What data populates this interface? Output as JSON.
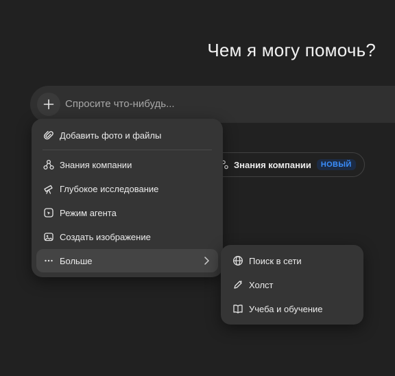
{
  "heading": "Чем я могу помочь?",
  "composer": {
    "placeholder": "Спросите что-нибудь..."
  },
  "chip": {
    "label": "Знания компании",
    "badge": "НОВЫЙ"
  },
  "menu": {
    "items": [
      {
        "label": "Добавить фото и файлы",
        "icon": "paperclip-icon"
      },
      {
        "label": "Знания компании",
        "icon": "connectors-icon"
      },
      {
        "label": "Глубокое исследование",
        "icon": "telescope-icon"
      },
      {
        "label": "Режим агента",
        "icon": "agent-icon"
      },
      {
        "label": "Создать изображение",
        "icon": "image-icon"
      },
      {
        "label": "Больше",
        "icon": "ellipsis-icon"
      }
    ]
  },
  "submenu": {
    "items": [
      {
        "label": "Поиск в сети",
        "icon": "globe-icon"
      },
      {
        "label": "Холст",
        "icon": "pen-icon"
      },
      {
        "label": "Учеба и обучение",
        "icon": "book-icon"
      }
    ]
  },
  "colors": {
    "background": "#212121",
    "menu": "#353535",
    "badge": "#3b8fff",
    "active_item": "#444444"
  }
}
